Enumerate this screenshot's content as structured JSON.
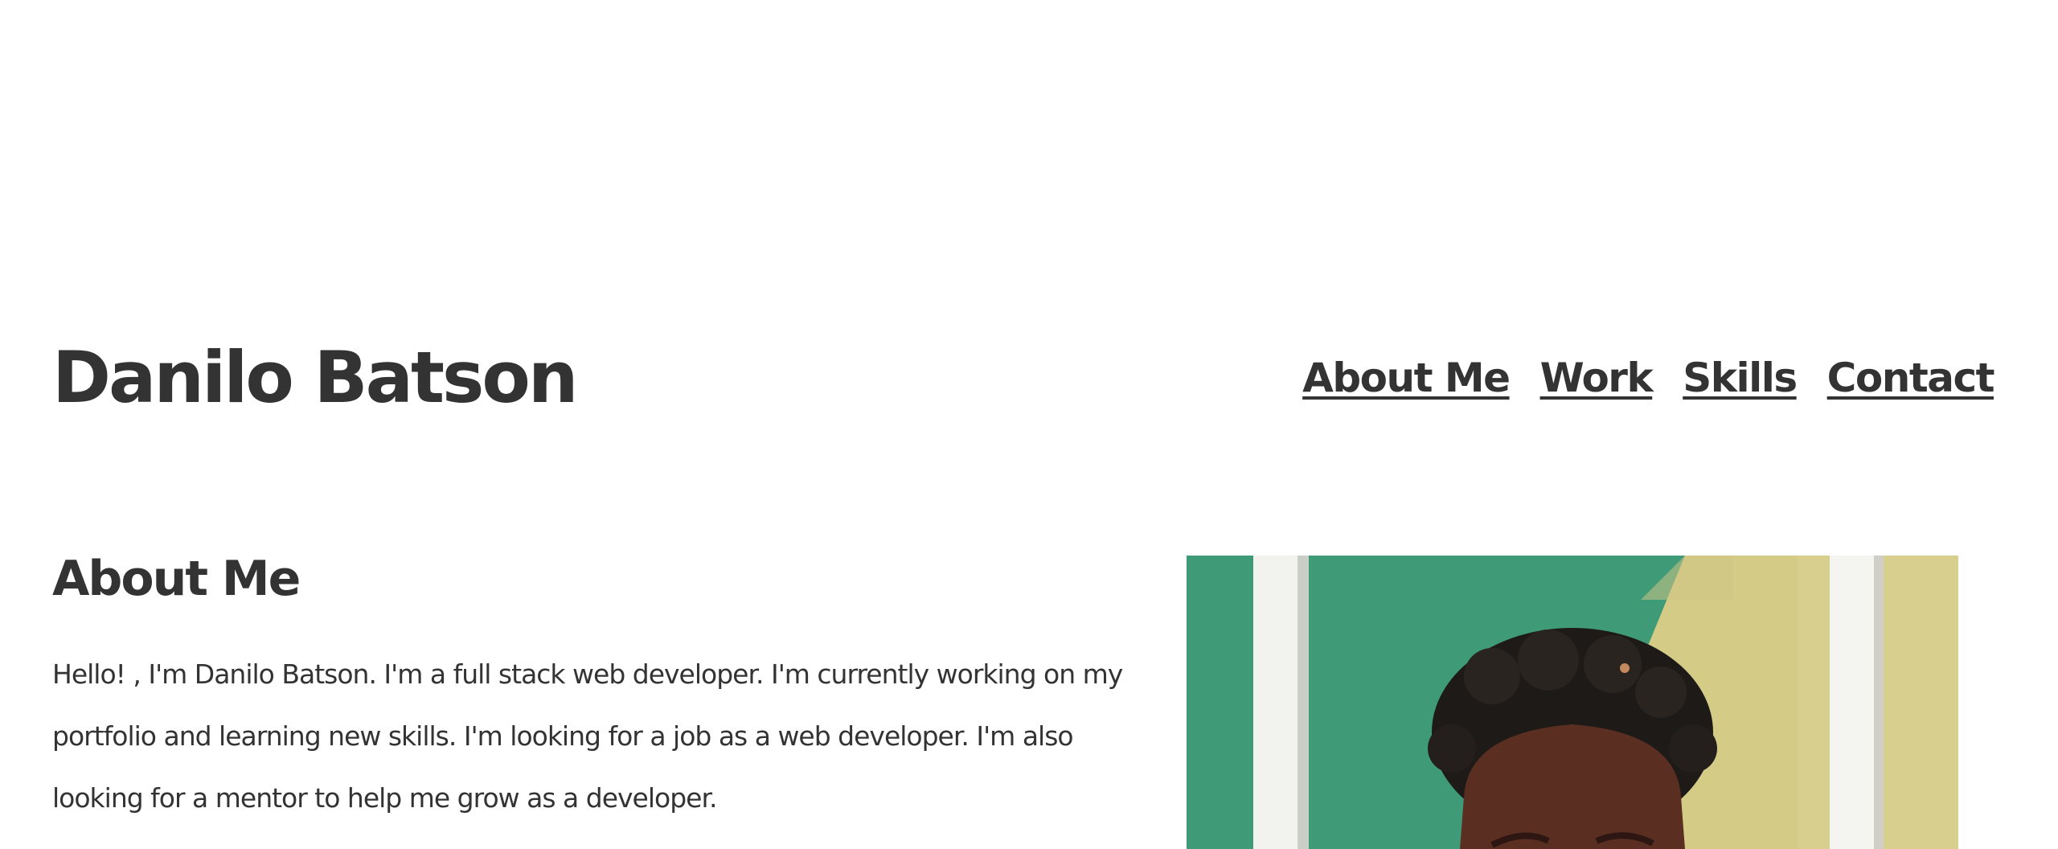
{
  "header": {
    "site_title": "Danilo Batson",
    "nav": [
      {
        "label": "About Me"
      },
      {
        "label": "Work"
      },
      {
        "label": "Skills"
      },
      {
        "label": "Contact"
      }
    ]
  },
  "about": {
    "heading": "About Me",
    "body": "Hello! , I'm Danilo Batson. I'm a full stack web developer. I'm currently working on my portfolio and learning new skills. I'm looking for a job as a web developer. I'm also looking for a mentor to help me grow as a developer."
  },
  "colors": {
    "text": "#333333",
    "background": "#ffffff",
    "photo_green": "#3f9a78",
    "photo_yellow": "#d8cf8e"
  }
}
